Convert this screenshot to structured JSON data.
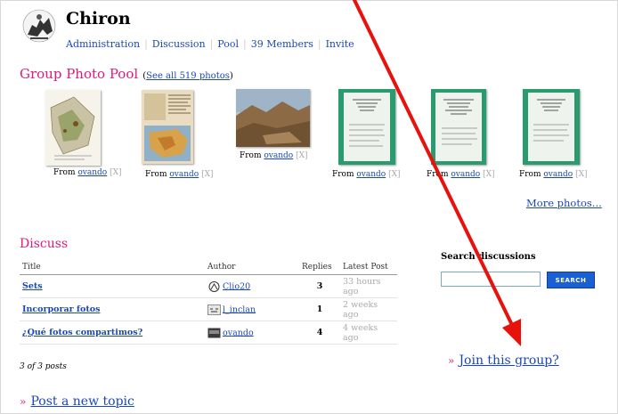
{
  "group": {
    "name": "Chiron"
  },
  "nav": {
    "items": [
      {
        "label": "Administration"
      },
      {
        "label": "Discussion"
      },
      {
        "label": "Pool"
      },
      {
        "label": "39 Members"
      },
      {
        "label": "Invite"
      }
    ]
  },
  "photo_pool": {
    "title": "Group Photo Pool",
    "open_paren": "(",
    "see_all": "See all 519 photos",
    "close_paren": ")",
    "from_label": "From",
    "owner": "ovando",
    "remove": "[X]",
    "more": "More photos..."
  },
  "discuss": {
    "title": "Discuss",
    "columns": {
      "title": "Title",
      "author": "Author",
      "replies": "Replies",
      "latest": "Latest Post"
    },
    "rows": [
      {
        "title": "Sets",
        "author": "Clio20",
        "replies": "3",
        "latest": "33 hours ago"
      },
      {
        "title": "Incorporar fotos",
        "author": "l_inclan",
        "replies": "1",
        "latest": "2 weeks ago"
      },
      {
        "title": "¿Qué fotos compartimos?",
        "author": "ovando",
        "replies": "4",
        "latest": "4 weeks ago"
      }
    ],
    "count": "3 of 3 posts",
    "post_new": "Post a new topic",
    "arrow": "»"
  },
  "search": {
    "title": "Search discussions",
    "button": "SEARCH"
  },
  "join": {
    "arrow": "»",
    "label": "Join this group?"
  },
  "colors": {
    "link": "#1a47b8",
    "heading": "#e0197a",
    "arrow": "#e8120c",
    "button": "#1a5fd4"
  }
}
